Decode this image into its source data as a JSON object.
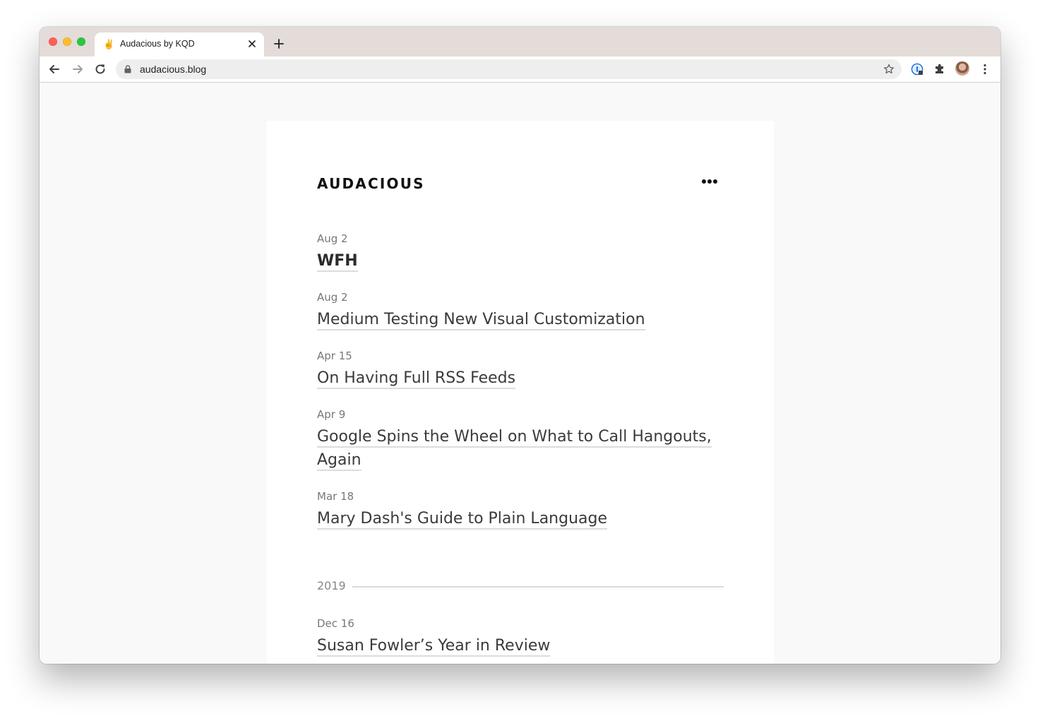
{
  "browser": {
    "tab": {
      "favicon": "✌",
      "title": "Audacious by KQD"
    },
    "address": {
      "url": "audacious.blog"
    }
  },
  "blog": {
    "brand": "AUDACIOUS",
    "posts": [
      {
        "date": "Aug 2",
        "title": "WFH"
      },
      {
        "date": "Aug 2",
        "title": "Medium Testing New Visual Customization"
      },
      {
        "date": "Apr 15",
        "title": "On Having Full RSS Feeds"
      },
      {
        "date": "Apr 9",
        "title": "Google Spins the Wheel on What to Call Hangouts, Again"
      },
      {
        "date": "Mar 18",
        "title": "Mary Dash's Guide to Plain Language"
      }
    ],
    "year_divider": "2019",
    "posts_2019": [
      {
        "date": "Dec 16",
        "title": "Susan Fowler’s Year in Review"
      }
    ]
  },
  "icons": {
    "back": "arrow-left-icon",
    "forward": "arrow-right-icon",
    "reload": "reload-icon",
    "lock": "lock-icon",
    "bookmark": "star-icon",
    "extensions": "puzzle-icon",
    "password_manager": "1password-icon",
    "menu": "kebab-icon",
    "more": "ellipsis-icon"
  },
  "colors": {
    "tabstrip": "#e3dcd8",
    "page_bg": "#f9f9f9",
    "card_bg": "#ffffff",
    "title_text": "#3a3a3a",
    "date_text": "#777777",
    "link_underline": "#dcdcdc"
  }
}
